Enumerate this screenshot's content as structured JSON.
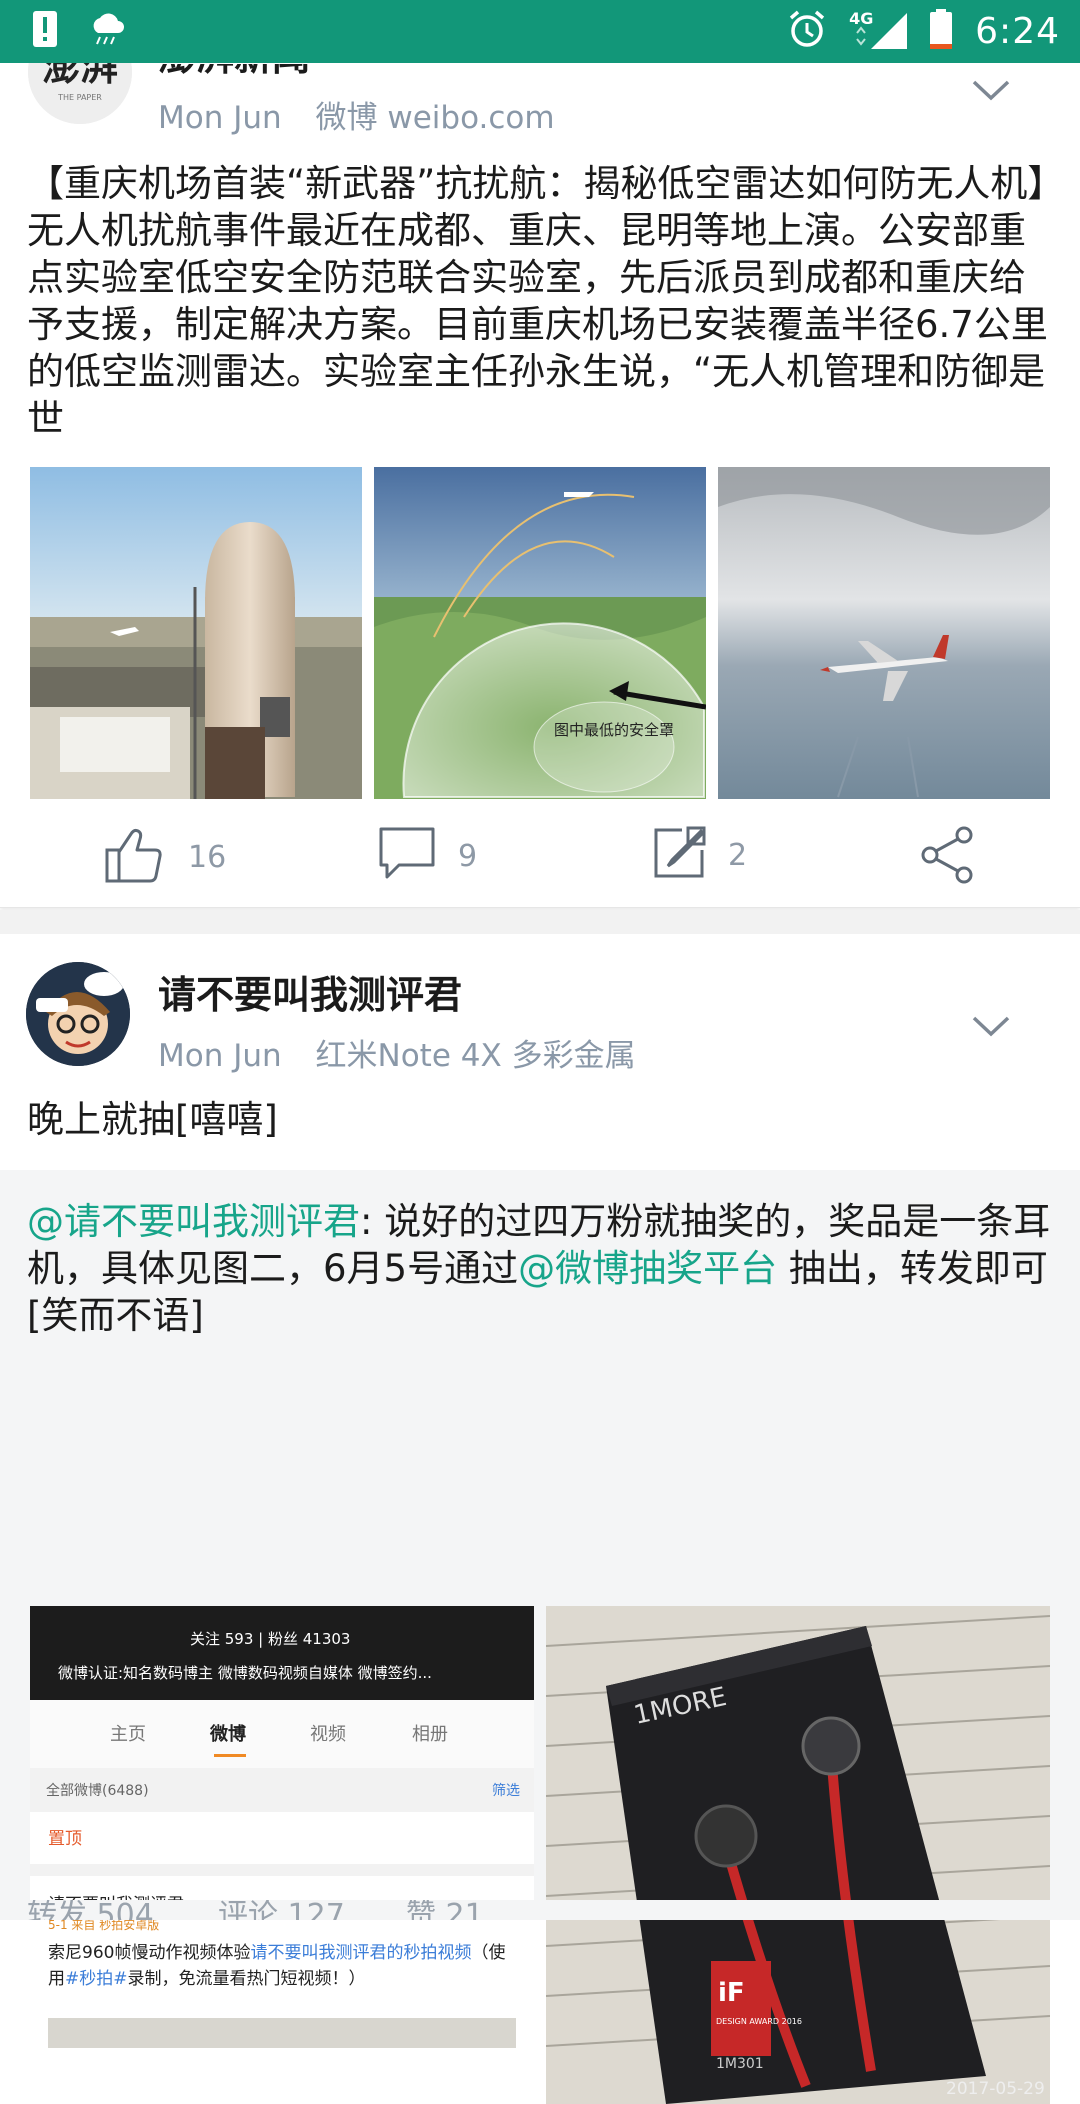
{
  "status_bar": {
    "time": "6:24",
    "network": "4G",
    "icons": [
      "warning-icon",
      "weather-rain-icon",
      "alarm-icon",
      "signal-icon",
      "battery-icon"
    ],
    "color": "#129779"
  },
  "post1": {
    "author": "澎湃新闻",
    "avatar_text": "澎湃",
    "date": "Mon Jun",
    "source": "微博 weibo.com",
    "text": "【重庆机场首装“新武器”抗扰航：揭秘低空雷达如何防无人机】无人机扰航事件最近在成都、重庆、昆明等地上演。公安部重点实验室低空安全防范联合实验室，先后派员到成都和重庆给予支援，制定解决方案。目前重庆机场已安装覆盖半径6.7公里的低空监测雷达。实验室主任孙永生说，“无人机管理和防御是世",
    "images": [
      {
        "name": "radar-tower-photo"
      },
      {
        "name": "radar-dome-diagram",
        "caption": "图中最低的安全罩"
      },
      {
        "name": "airplane-photo"
      }
    ],
    "likes": "16",
    "comments": "9",
    "reposts": "2"
  },
  "post2": {
    "author": "请不要叫我测评君",
    "date": "Mon Jun",
    "source": "红米Note 4X 多彩金属",
    "text": "晚上就抽[嘻嘻]",
    "repost": {
      "mention1": "@请不要叫我测评君",
      "text_a": ": 说好的过四万粉就抽奖的，奖品是一条耳机，具体见图二，6月5号通过",
      "mention2": "@微博抽奖平台",
      "text_b": " 抽出，转发即可[笑而不语]",
      "shot": {
        "follow": "关注 593  |  粉丝 41303",
        "verify": "微博认证:知名数码博主 微博数码视频自媒体 微博签约...",
        "tabs": [
          "主页",
          "微博",
          "视频",
          "相册"
        ],
        "all_posts": "全部微博(6488)",
        "filter": "筛选",
        "pinned": "置顶",
        "name": "请不要叫我测评君",
        "meta": "5-1 来自 秒拍安卓版",
        "body_a": "索尼960帧慢动作视频体验",
        "body_link": "请不要叫我测评君的秒拍视频",
        "body_b": "（使用",
        "body_tag": "#秒拍#",
        "body_c": "录制，免流量看热门短视频！）"
      },
      "box": {
        "brand": "1MORE",
        "award": "DESIGN AWARD 2016",
        "model": "1M301",
        "date_stamp": "2017-05-29"
      }
    },
    "bottom": {
      "forward": "转发 504",
      "comment": "评论 127",
      "like": "赞 21"
    }
  }
}
